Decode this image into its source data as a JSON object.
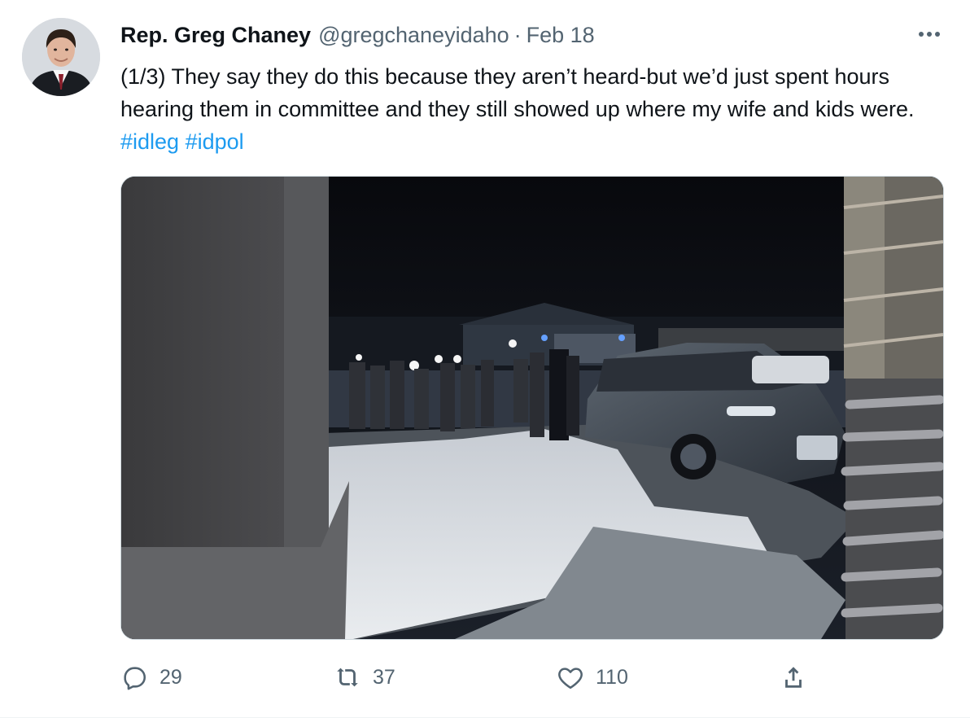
{
  "tweet": {
    "author_name": "Rep. Greg Chaney",
    "handle": "@gregchaneyidaho",
    "separator": "·",
    "date": "Feb 18",
    "text_main": "(1/3) They say they do this because they aren’t heard-but we’d just spent hours hearing them in committee and they still showed up where my wife and kids were. ",
    "hashtags": [
      "#idleg",
      "#idpol"
    ],
    "media_icon": "photo-icon"
  },
  "actions": {
    "reply": {
      "count": "29",
      "icon": "reply-icon"
    },
    "retweet": {
      "count": "37",
      "icon": "retweet-icon"
    },
    "like": {
      "count": "110",
      "icon": "heart-icon"
    },
    "share": {
      "icon": "share-icon"
    }
  },
  "colors": {
    "text": "#0f1419",
    "secondary": "#536471",
    "link": "#1d9bf0",
    "border": "#cfd9de"
  }
}
